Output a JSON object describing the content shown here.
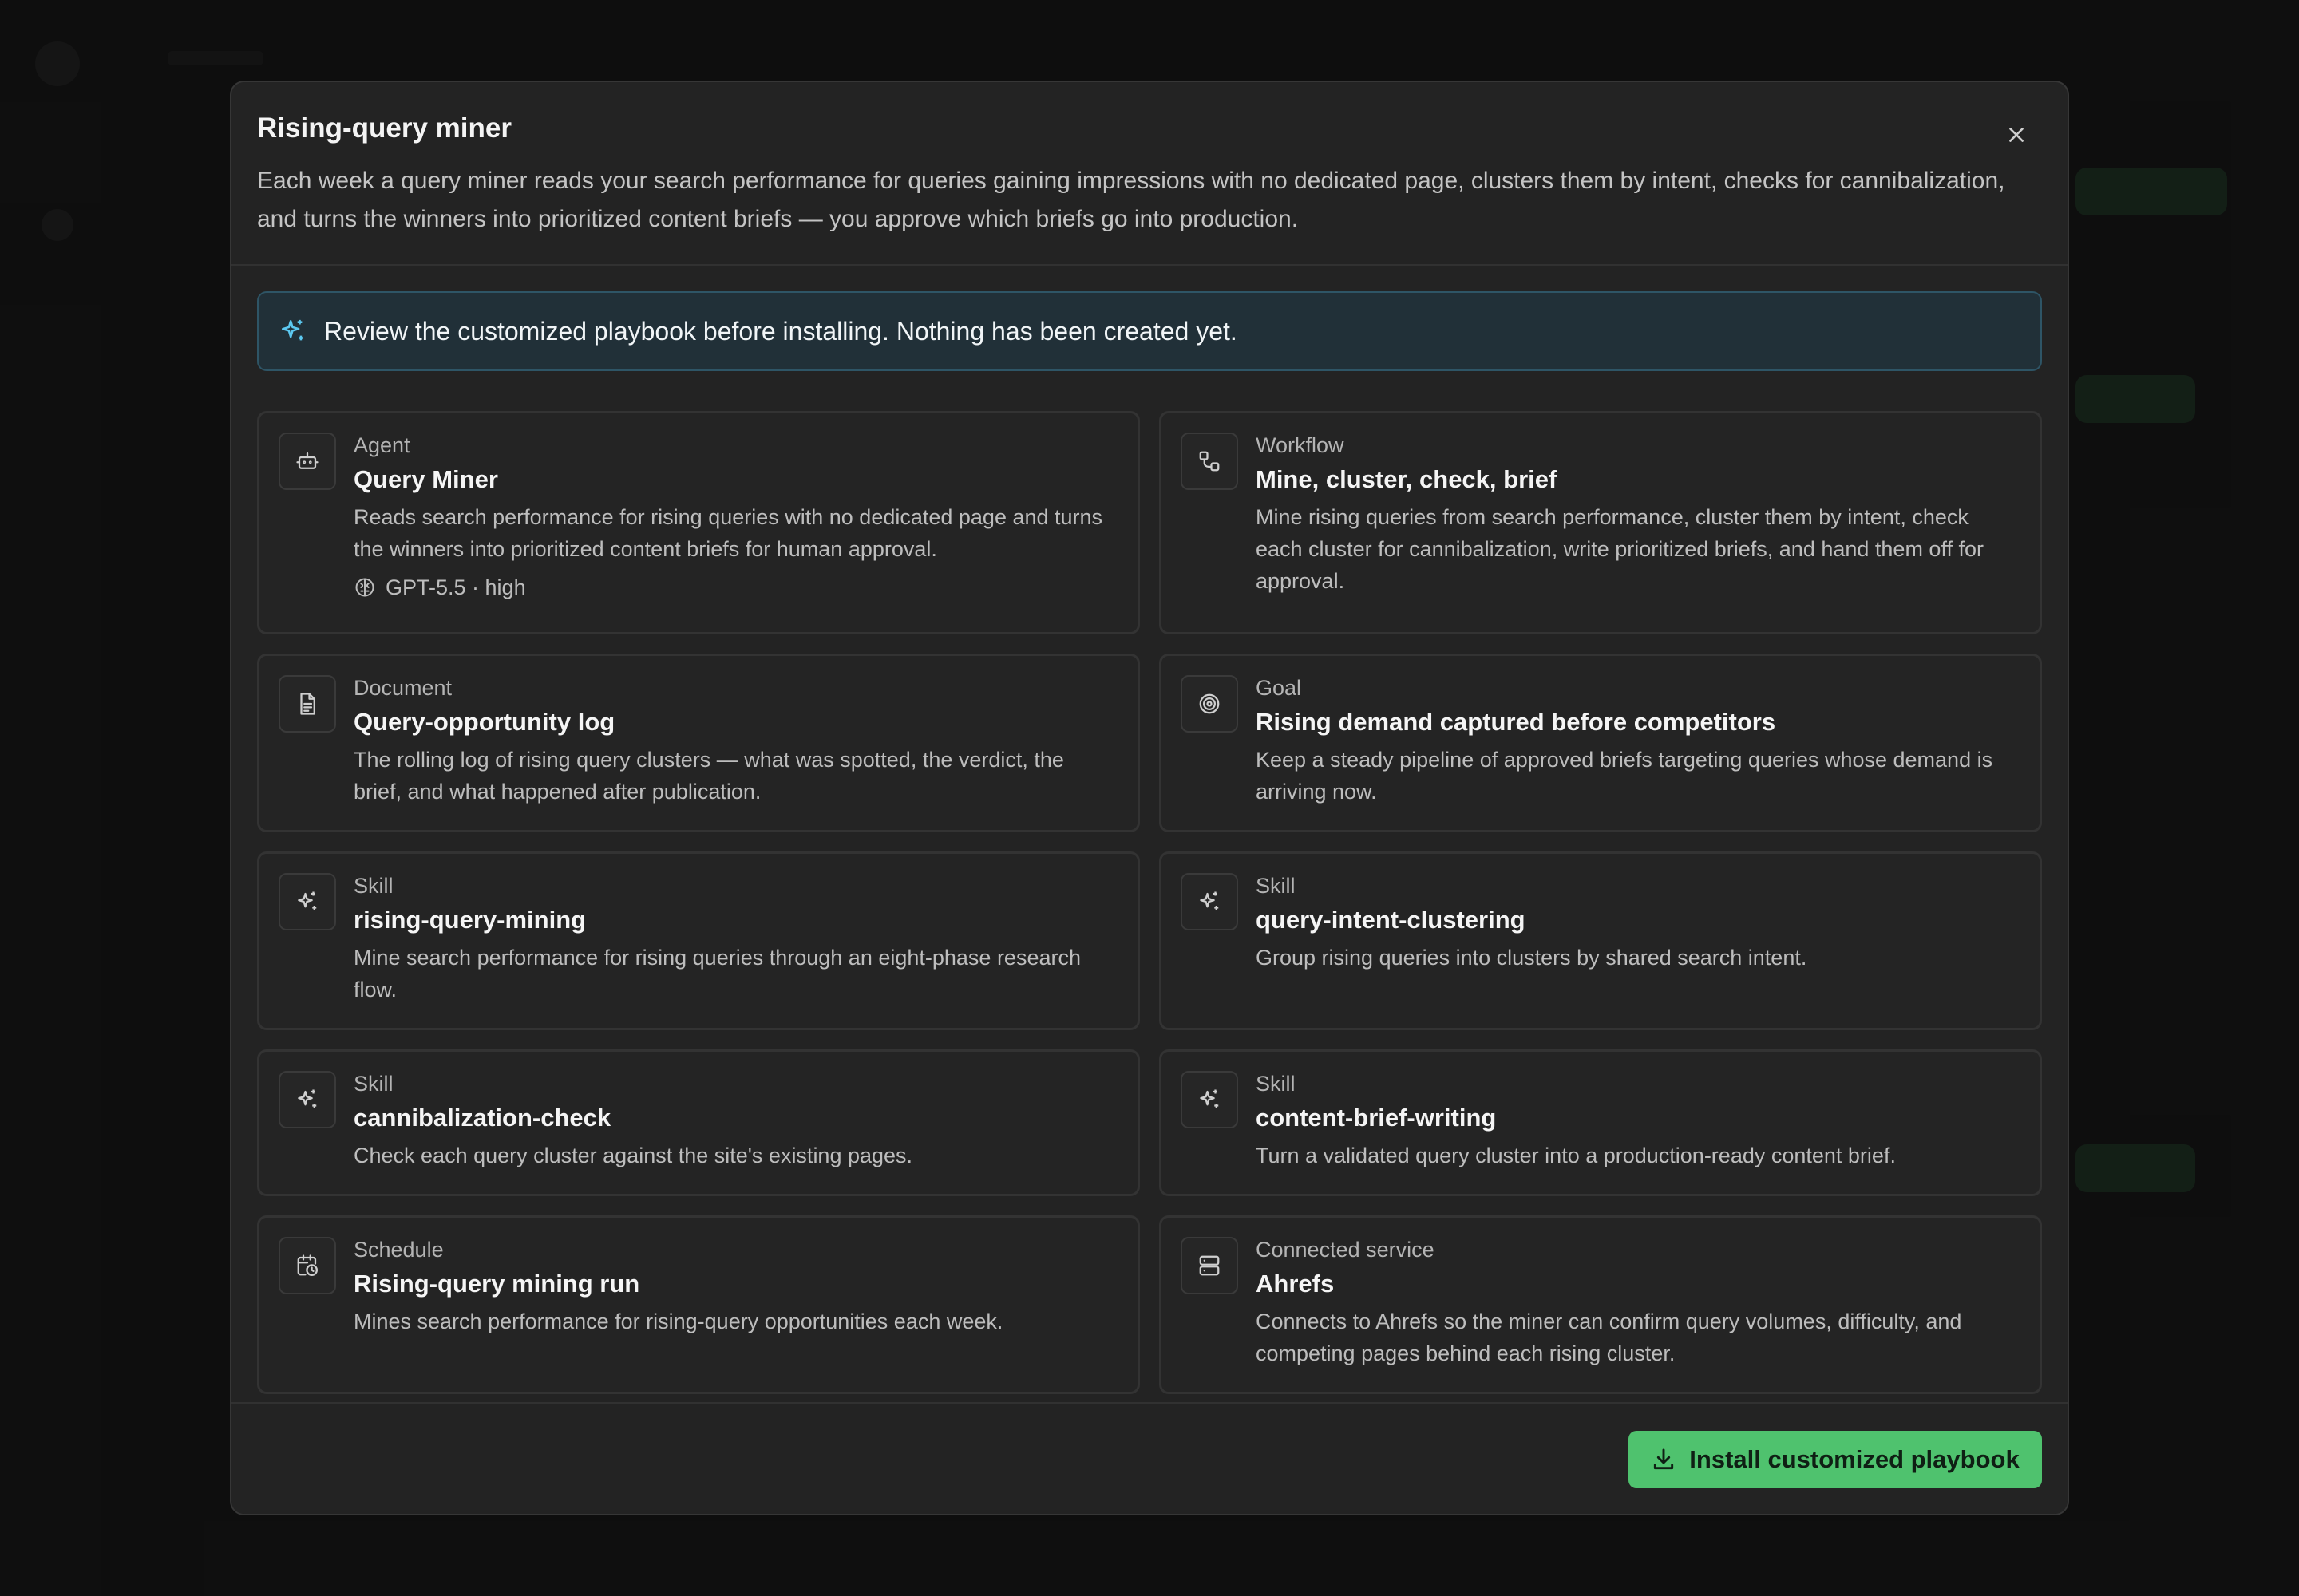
{
  "modal": {
    "title": "Rising-query miner",
    "description": "Each week a query miner reads your search performance for queries gaining impressions with no dedicated page, clusters them by intent, checks for cannibalization, and turns the winners into prioritized content briefs — you approve which briefs go into production.",
    "close_icon": "close-icon"
  },
  "banner": {
    "icon": "sparkles-icon",
    "text": "Review the customized playbook before installing. Nothing has been created yet."
  },
  "cards": [
    {
      "kind": "Agent",
      "title": "Query Miner",
      "description": "Reads search performance for rising queries with no dedicated page and turns the winners into prioritized content briefs for human approval.",
      "meta": "GPT-5.5 · high",
      "icon": "robot-icon"
    },
    {
      "kind": "Workflow",
      "title": "Mine, cluster, check, brief",
      "description": "Mine rising queries from search performance, cluster them by intent, check each cluster for cannibalization, write prioritized briefs, and hand them off for approval.",
      "icon": "workflow-icon"
    },
    {
      "kind": "Document",
      "title": "Query-opportunity log",
      "description": "The rolling log of rising query clusters — what was spotted, the verdict, the brief, and what happened after publication.",
      "icon": "document-icon"
    },
    {
      "kind": "Goal",
      "title": "Rising demand captured before competitors",
      "description": "Keep a steady pipeline of approved briefs targeting queries whose demand is arriving now.",
      "icon": "target-icon"
    },
    {
      "kind": "Skill",
      "title": "rising-query-mining",
      "description": "Mine search performance for rising queries through an eight-phase research flow.",
      "icon": "sparkles-icon"
    },
    {
      "kind": "Skill",
      "title": "query-intent-clustering",
      "description": "Group rising queries into clusters by shared search intent.",
      "icon": "sparkles-icon"
    },
    {
      "kind": "Skill",
      "title": "cannibalization-check",
      "description": "Check each query cluster against the site's existing pages.",
      "icon": "sparkles-icon"
    },
    {
      "kind": "Skill",
      "title": "content-brief-writing",
      "description": "Turn a validated query cluster into a production-ready content brief.",
      "icon": "sparkles-icon"
    },
    {
      "kind": "Schedule",
      "title": "Rising-query mining run",
      "description": "Mines search performance for rising-query opportunities each week.",
      "icon": "calendar-clock-icon"
    },
    {
      "kind": "Connected service",
      "title": "Ahrefs",
      "description": "Connects to Ahrefs so the miner can confirm query volumes, difficulty, and competing pages behind each rising cluster.",
      "icon": "server-icon"
    }
  ],
  "footer": {
    "install_label": "Install customized playbook",
    "install_icon": "download-icon"
  },
  "colors": {
    "accent_green": "#4fc26e",
    "banner_bg": "#213038",
    "banner_icon": "#5cc8f0"
  }
}
